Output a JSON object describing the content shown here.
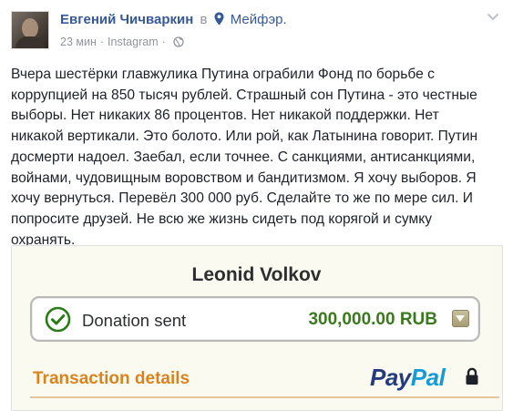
{
  "post": {
    "author": "Евгений Чичваркин",
    "in_word": "в",
    "location": "Мейфэр.",
    "time": "23 мин",
    "source": "Instagram",
    "separator": "·",
    "text_lines": [
      "Вчера шестёрки главжулика Путина ограбили Фонд по борьбе с",
      "коррупцией на 850 тысяч рублей. Страшный сон Путина - это честные",
      "выборы. Нет никаких 86 процентов. Нет никакой поддержки. Нет",
      "никакой вертикали. Это болото. Или рой, как Латынина говорит. Путин",
      "досмерти надоел. Заебал, если точнее. С санкциями, антисанкциями,",
      "войнами, чудовищным воровством и бандитизмом. Я хочу выборов. Я",
      "хочу вернуться. Перевёл 300 000 руб. Сделайте то же по мере сил. И",
      "попросите друзей. Не всю же жизнь сидеть под корягой и сумку",
      "охранять."
    ]
  },
  "attachment": {
    "recipient": "Leonid Volkov",
    "status": "Donation sent",
    "amount": "300,000.00 RUB",
    "section_title": "Transaction details",
    "brand_pay": "Pay",
    "brand_pal": "Pal"
  },
  "colors": {
    "link": "#365899",
    "amount_green": "#3a7a1d",
    "section_orange": "#d9831f",
    "paypal_dark": "#253b80",
    "paypal_light": "#179bd7"
  },
  "icons": {
    "location": "map-pin",
    "privacy": "globe",
    "menu": "chevron-down",
    "status": "check-circle",
    "secure": "lock"
  }
}
